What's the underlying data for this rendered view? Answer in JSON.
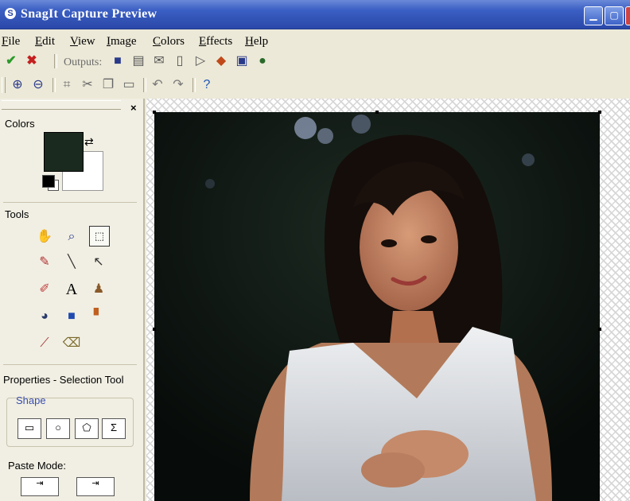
{
  "window": {
    "title": "SnagIt Capture Preview",
    "buttons": [
      "minimize",
      "maximize",
      "close"
    ]
  },
  "menu": [
    "File",
    "Edit",
    "View",
    "Image",
    "Colors",
    "Effects",
    "Help"
  ],
  "toolbar1": {
    "outputs_label": "Outputs:",
    "icons": [
      "accept-check-icon",
      "reject-x-icon",
      "save-icon",
      "print-icon",
      "email-icon",
      "clipboard-icon",
      "send-icon",
      "catalog-icon",
      "web-icon",
      "program-icon"
    ]
  },
  "toolbar2": {
    "icons": [
      "zoom-in-icon",
      "zoom-out-icon",
      "crop-icon",
      "cut-icon",
      "copy-icon",
      "paste-icon",
      "undo-icon",
      "redo-icon",
      "help-icon"
    ]
  },
  "panel": {
    "colors_label": "Colors",
    "tools_label": "Tools",
    "properties_label": "Properties - Selection Tool",
    "shape_label": "Shape",
    "paste_mode_label": "Paste Mode:",
    "tools": [
      "hand-icon",
      "zoom-icon",
      "selection-icon",
      "pen-icon",
      "line-icon",
      "arrow-icon",
      "highlighter-icon",
      "text-icon",
      "stamp-icon",
      "fill-icon",
      "shape-icon",
      "spray-icon",
      "eyedropper-icon",
      "eraser-icon"
    ],
    "colors": {
      "foreground": "#1b2a1f",
      "background": "#ffffff"
    }
  },
  "accent": "#2a48a8"
}
